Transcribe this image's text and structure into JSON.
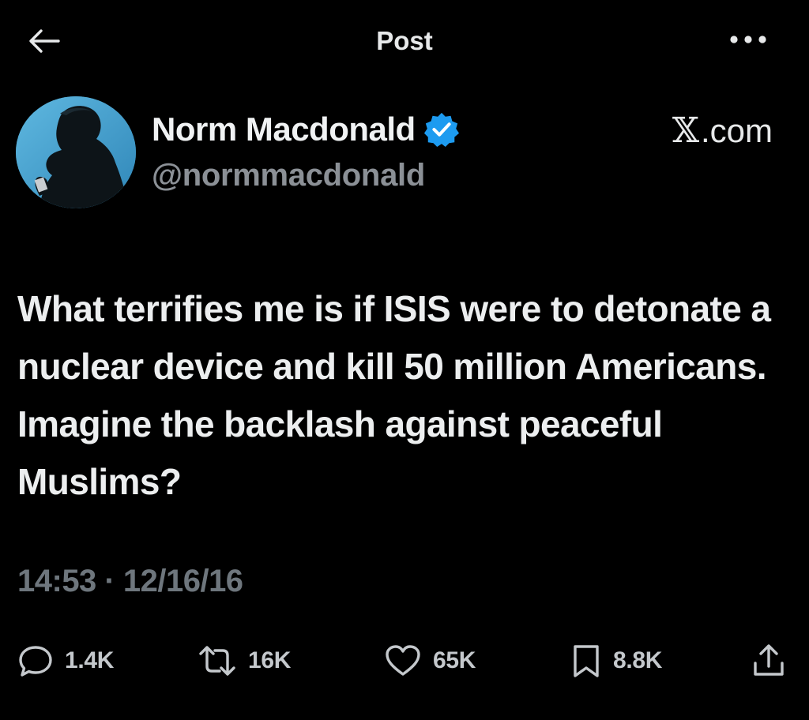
{
  "header": {
    "title": "Post",
    "back_icon": "arrow-left-icon",
    "more_icon": "more-horizontal-icon"
  },
  "author": {
    "display_name": "Norm Macdonald",
    "handle": "@normmacdonald",
    "verified": true,
    "verified_color": "#1d9bf0"
  },
  "source": {
    "mark": "𝕏",
    "text": ".com"
  },
  "tweet": {
    "text": "What terrifies me is if ISIS were to detonate a nuclear device and kill 50 million Americans. Imagine the backlash against peaceful Muslims?",
    "timestamp": "14:53 · 12/16/16"
  },
  "actions": {
    "reply": {
      "icon": "reply-icon",
      "count": "1.4K"
    },
    "repost": {
      "icon": "repost-icon",
      "count": "16K"
    },
    "like": {
      "icon": "heart-icon",
      "count": "65K"
    },
    "bookmark": {
      "icon": "bookmark-icon",
      "count": "8.8K"
    },
    "share": {
      "icon": "share-icon"
    }
  },
  "colors": {
    "background": "#000000",
    "text_primary": "#e7e9ea",
    "text_secondary": "#6e767d",
    "accent": "#1d9bf0"
  }
}
